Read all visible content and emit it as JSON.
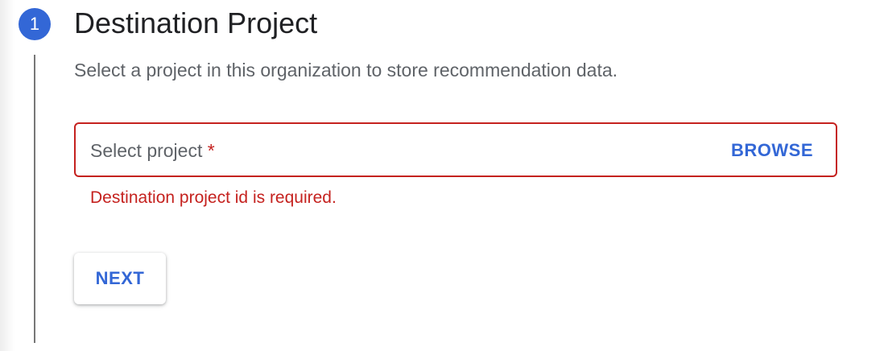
{
  "step": {
    "number": "1",
    "title": "Destination Project",
    "description": "Select a project in this organization to store recommendation data."
  },
  "project_field": {
    "label": "Select project",
    "required_marker": "*",
    "browse_label": "BROWSE",
    "error_message": "Destination project id is required."
  },
  "actions": {
    "next_label": "NEXT"
  },
  "colors": {
    "accent": "#3367d6",
    "error": "#c5221f"
  }
}
